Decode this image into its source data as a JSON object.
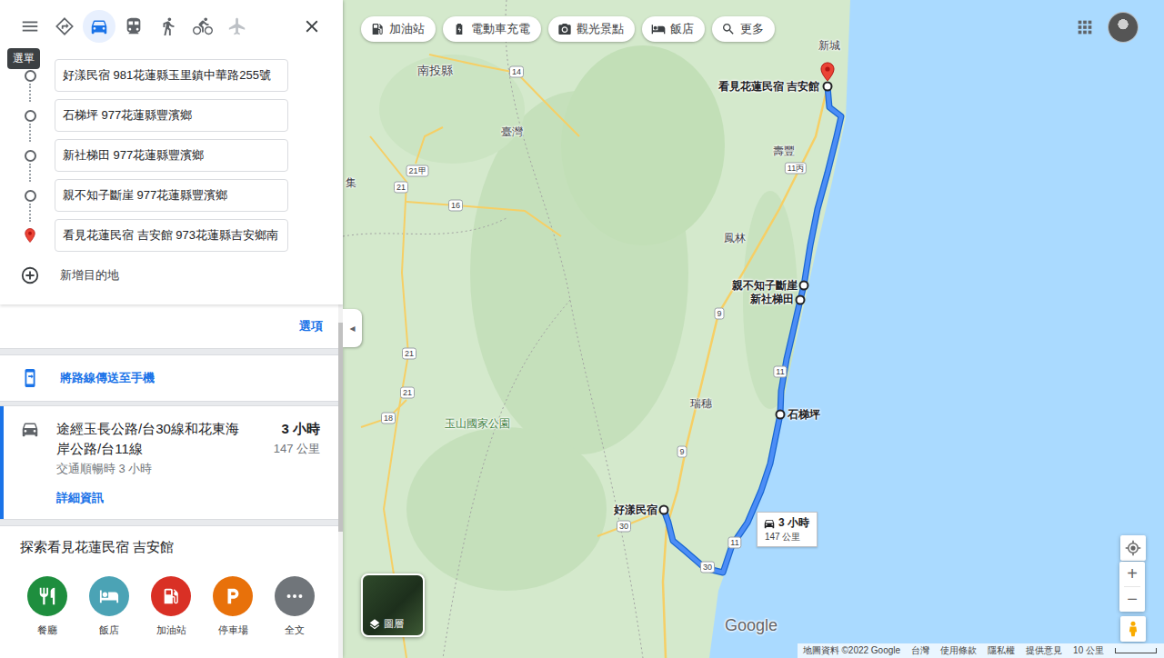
{
  "sidebar": {
    "menu_tooltip": "選單",
    "travel_modes": [
      {
        "kind": "best",
        "selected": false,
        "disabled": false
      },
      {
        "kind": "car",
        "selected": true,
        "disabled": false
      },
      {
        "kind": "transit",
        "selected": false,
        "disabled": false
      },
      {
        "kind": "walk",
        "selected": false,
        "disabled": false
      },
      {
        "kind": "bike",
        "selected": false,
        "disabled": false
      },
      {
        "kind": "flight",
        "selected": false,
        "disabled": true
      }
    ],
    "waypoints": [
      {
        "value": "好漾民宿 981花蓮縣玉里鎮中華路255號",
        "kind": "stop"
      },
      {
        "value": "石梯坪 977花蓮縣豐濱鄉",
        "kind": "stop"
      },
      {
        "value": "新社梯田 977花蓮縣豐濱鄉",
        "kind": "stop"
      },
      {
        "value": "親不知子斷崖 977花蓮縣豐濱鄉",
        "kind": "stop"
      },
      {
        "value": "看見花蓮民宿 吉安館 973花蓮縣吉安鄉南",
        "kind": "destination"
      }
    ],
    "add_destination": "新增目的地",
    "options": "選項",
    "send_to_phone": "將路線傳送至手機",
    "route": {
      "via": "途經玉長公路/台30線和花東海岸公路/台11線",
      "duration": "3 小時",
      "distance": "147 公里",
      "traffic": "交通順暢時 3 小時",
      "details": "詳細資訊",
      "selected": true
    },
    "explore": {
      "title": "探索看見花蓮民宿 吉安館",
      "items": [
        {
          "label": "餐廳",
          "kind": "restaurant",
          "color": "#1e8e3e"
        },
        {
          "label": "飯店",
          "kind": "hotel",
          "color": "#4ba3b5"
        },
        {
          "label": "加油站",
          "kind": "gas",
          "color": "#d93025"
        },
        {
          "label": "停車場",
          "kind": "parking",
          "color": "#e8710a"
        },
        {
          "label": "全文",
          "kind": "more",
          "color": "#70757a"
        }
      ]
    }
  },
  "collapse_toggle": "◂",
  "map": {
    "chips": [
      {
        "label": "加油站",
        "kind": "gas"
      },
      {
        "label": "電動車充電",
        "kind": "ev"
      },
      {
        "label": "觀光景點",
        "kind": "camera"
      },
      {
        "label": "飯店",
        "kind": "hotel"
      },
      {
        "label": "更多",
        "kind": "search"
      }
    ],
    "places": [
      {
        "label": "新城"
      },
      {
        "label": "南投縣"
      },
      {
        "label": "臺灣"
      },
      {
        "label": "集"
      },
      {
        "label": "壽豐"
      },
      {
        "label": "鳳林"
      },
      {
        "label": "瑞穗"
      },
      {
        "label": "玉山國家公園"
      }
    ],
    "road_shields": [
      {
        "label": "14"
      },
      {
        "label": "21甲"
      },
      {
        "label": "21"
      },
      {
        "label": "16"
      },
      {
        "label": "11丙"
      },
      {
        "label": "9"
      },
      {
        "label": "11"
      },
      {
        "label": "9"
      },
      {
        "label": "21"
      },
      {
        "label": "21"
      },
      {
        "label": "18"
      },
      {
        "label": "30"
      },
      {
        "label": "11"
      },
      {
        "label": "30"
      }
    ],
    "waypoint_labels": [
      {
        "label": "看見花蓮民宿 吉安館",
        "kind": "destination"
      },
      {
        "label": "親不知子斷崖",
        "kind": "stop"
      },
      {
        "label": "新社梯田",
        "kind": "stop"
      },
      {
        "label": "石梯坪",
        "kind": "stop"
      },
      {
        "label": "好漾民宿",
        "kind": "stop"
      }
    ],
    "route_callout": {
      "duration": "3 小時",
      "distance": "147 公里"
    },
    "layers_label": "圖層",
    "zoom_in": "+",
    "zoom_out": "−",
    "logo": "Google",
    "footer": [
      "地圖資料 ©2022 Google",
      "台灣",
      "使用條款",
      "隱私權",
      "提供意見"
    ],
    "scale": "10 公里"
  }
}
